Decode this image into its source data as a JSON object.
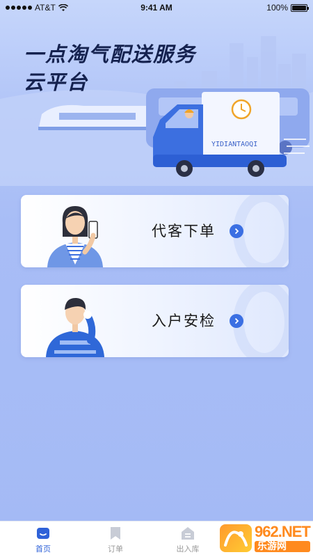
{
  "status_bar": {
    "carrier": "AT&T",
    "time": "9:41 AM",
    "battery": "100%"
  },
  "hero": {
    "title_line1": "一点淘气配送服务",
    "title_line2": "云平台",
    "truck_text": "YIDIANTAOQI"
  },
  "cards": [
    {
      "label": "代客下单"
    },
    {
      "label": "入户安检"
    }
  ],
  "tabbar": {
    "tabs": [
      {
        "label": "首页",
        "active": true
      },
      {
        "label": "订单",
        "active": false
      },
      {
        "label": "出入库",
        "active": false
      }
    ]
  },
  "watermark": {
    "main": "962.NET",
    "sub": "乐游网"
  },
  "colors": {
    "accent": "#2f62d8",
    "title": "#15224f",
    "background": "#a8bdf6"
  }
}
